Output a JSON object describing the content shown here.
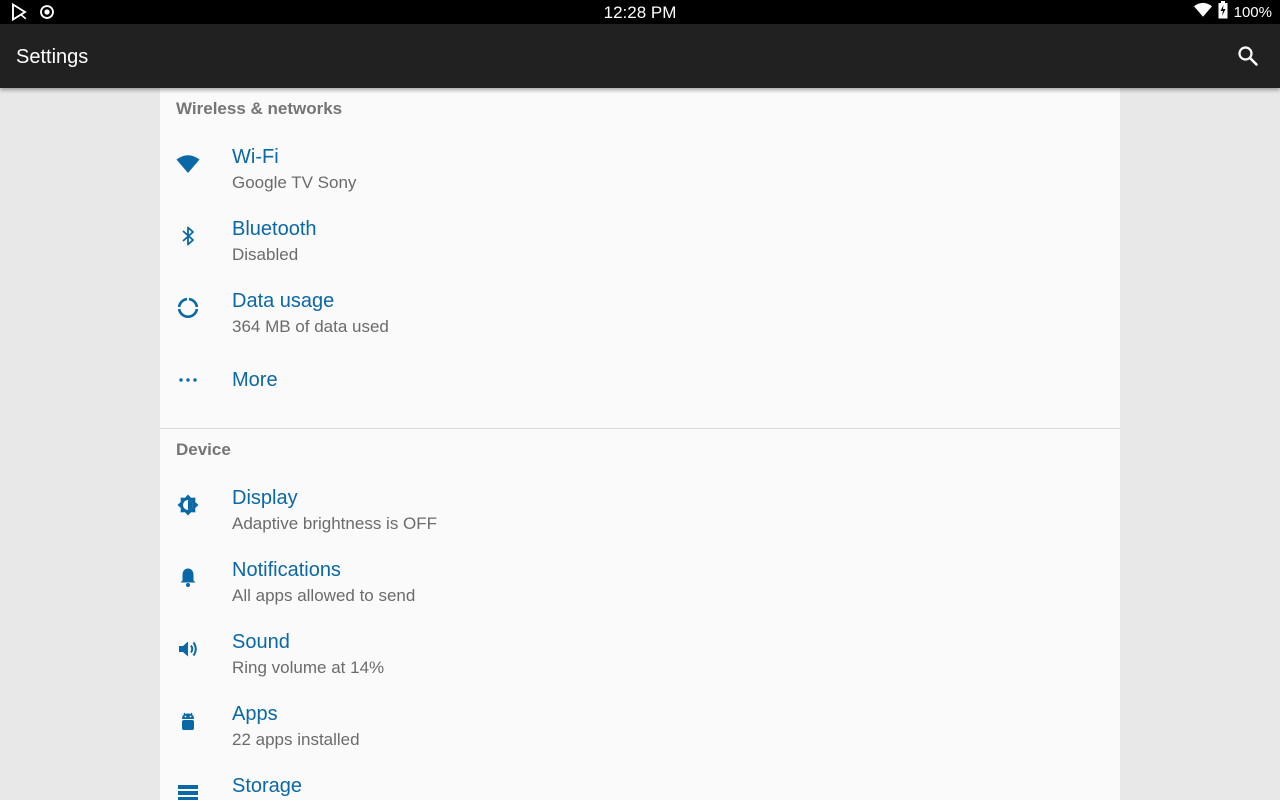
{
  "status_bar": {
    "time": "12:28 PM",
    "battery": "100%"
  },
  "app_bar": {
    "title": "Settings"
  },
  "sections": [
    {
      "header": "Wireless & networks",
      "items": [
        {
          "title": "Wi-Fi",
          "summary": "Google TV Sony",
          "icon": "wifi-icon"
        },
        {
          "title": "Bluetooth",
          "summary": "Disabled",
          "icon": "bluetooth-icon"
        },
        {
          "title": "Data usage",
          "summary": "364 MB of data used",
          "icon": "data-usage-icon"
        },
        {
          "title": "More",
          "summary": "",
          "icon": "more-dots-icon"
        }
      ]
    },
    {
      "header": "Device",
      "items": [
        {
          "title": "Display",
          "summary": "Adaptive brightness is OFF",
          "icon": "brightness-icon"
        },
        {
          "title": "Notifications",
          "summary": "All apps allowed to send",
          "icon": "bell-icon"
        },
        {
          "title": "Sound",
          "summary": "Ring volume at 14%",
          "icon": "speaker-icon"
        },
        {
          "title": "Apps",
          "summary": "22 apps installed",
          "icon": "android-icon"
        },
        {
          "title": "Storage",
          "summary": "",
          "icon": "storage-icon"
        }
      ]
    }
  ],
  "colors": {
    "accent": "#0b68a6",
    "app_bar": "#212121",
    "background": "#fafafa"
  }
}
